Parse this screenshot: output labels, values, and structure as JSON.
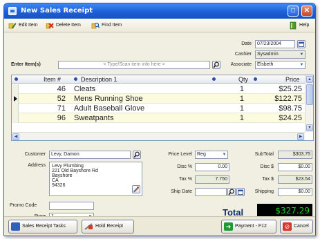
{
  "window": {
    "title": "New Sales Receipt"
  },
  "toolbar": {
    "edit_item": "Edit Item",
    "delete_item": "Delete Item",
    "find_item": "Find Item",
    "help": "Help"
  },
  "header": {
    "date_label": "Date",
    "date_value": "07/23/2004",
    "cashier_label": "Cashier",
    "cashier_value": "Sysadmin",
    "associate_label": "Associate",
    "associate_value": "Elsbeth",
    "enter_items_label": "Enter Item(s)",
    "enter_items_placeholder": "< Type/Scan item info here >"
  },
  "grid": {
    "columns": {
      "item_no": "Item #",
      "description": "Description 1",
      "qty": "Qty",
      "price": "Price"
    },
    "rows": [
      {
        "item_no": "46",
        "description": "Cleats",
        "qty": "1",
        "price": "$25.25"
      },
      {
        "item_no": "52",
        "description": "Mens Running Shoe",
        "qty": "1",
        "price": "$122.75"
      },
      {
        "item_no": "71",
        "description": "Adult Baseball Glove",
        "qty": "1",
        "price": "$98.75"
      },
      {
        "item_no": "96",
        "description": "Sweatpants",
        "qty": "1",
        "price": "$24.25"
      }
    ]
  },
  "customer": {
    "customer_label": "Customer",
    "customer_value": "Levy, Damon",
    "address_label": "Address",
    "address_lines": [
      "Levy Plumbing",
      "221 Old Bayshore Rd",
      "Bayshore",
      "CA",
      "94326"
    ],
    "promo_label": "Promo Code",
    "promo_value": "",
    "store_label": "Store",
    "store_value": "1"
  },
  "pricing": {
    "price_level_label": "Price Level",
    "price_level_value": "Reg",
    "disc_pct_label": "Disc %",
    "disc_pct_value": "0.00",
    "tax_pct_label": "Tax %",
    "tax_pct_value": "7.750",
    "ship_date_label": "Ship Date",
    "ship_date_value": ""
  },
  "totals": {
    "subtotal_label": "SubTotal",
    "subtotal_value": "$303.75",
    "disc_amt_label": "Disc $",
    "disc_amt_value": "$0.00",
    "tax_amt_label": "Tax $",
    "tax_amt_value": "$23.54",
    "shipping_label": "Shipping",
    "shipping_value": "$0.00",
    "total_label": "Total",
    "total_value": "$327.29"
  },
  "footer": {
    "tasks": "Sales Receipt Tasks",
    "hold": "Hold Receipt",
    "payment": "Payment - F12",
    "cancel": "Cancel"
  }
}
